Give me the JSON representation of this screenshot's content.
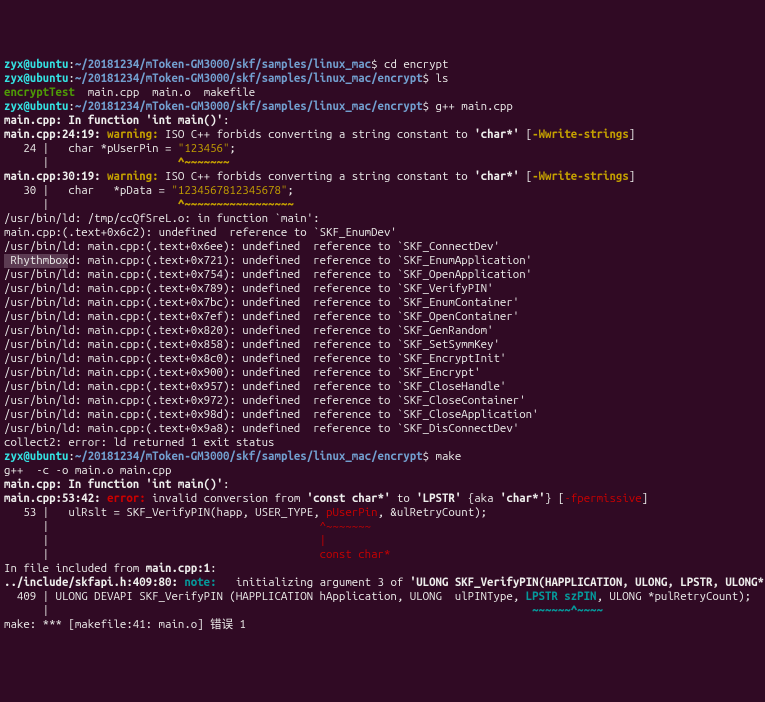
{
  "prompt": {
    "user": "zyx@ubuntu",
    "path1": "~/20181234/mToken-GM3000/skf/samples/linux_mac",
    "path2": "~/20181234/mToken-GM3000/skf/samples/linux_mac/encrypt",
    "dollar": "$"
  },
  "cmds": {
    "cd": "cd encrypt",
    "ls": "ls",
    "gpp": "g++ main.cpp",
    "make": "make"
  },
  "ls_out": {
    "exe": "encryptTest",
    "f1": "main.cpp",
    "f2": "main.o",
    "f3": "makefile"
  },
  "gpp": {
    "infunc": "main.cpp: In function",
    "infunc_b": "'int main()'",
    "infunc_c": ":",
    "w1a": "main.cpp:24:19:",
    "warn": "warning:",
    "w1b": "ISO C++ forbids converting a string constant to",
    "w1c": "'char*'",
    "w1d": " [",
    "w1opt": "-Wwrite-strings",
    "w1e": "]",
    "l24a": "   24 |   char *pUserPin = ",
    "l24b": "\"123456\"",
    "l24c": ";",
    "l24u": "      |                    ",
    "l24u2": "^~~~~~~~",
    "w2a": "main.cpp:30:19:",
    "w2b": "ISO C++ forbids converting a string constant to",
    "w2c": "'char*'",
    "l30a": "   30 |   char   *pData = ",
    "l30b": "\"1234567812345678\"",
    "l30c": ";",
    "l30u": "      |                    ",
    "l30u2": "^~~~~~~~~~~~~~~~~~",
    "ld_main": "/usr/bin/ld: /tmp/ccQfSreL.o: in function `main':",
    "ldp": "/usr/bin/ld: main.cpp:(.text+",
    "ld_first": "main.cpp:(.text+",
    "ldmid": "): undefined  reference to `",
    "refs": [
      {
        "off": "0x6c2",
        "sym": "SKF_EnumDev'"
      },
      {
        "off": "0x6ee",
        "sym": "SKF_ConnectDev'"
      },
      {
        "off": "0x721",
        "sym": "SKF_EnumApplication'"
      },
      {
        "off": "0x754",
        "sym": "SKF_OpenApplication'"
      },
      {
        "off": "0x789",
        "sym": "SKF_VerifyPIN'"
      },
      {
        "off": "0x7bc",
        "sym": "SKF_EnumContainer'"
      },
      {
        "off": "0x7ef",
        "sym": "SKF_OpenContainer'"
      },
      {
        "off": "0x820",
        "sym": "SKF_GenRandom'"
      },
      {
        "off": "0x858",
        "sym": "SKF_SetSymmKey'"
      },
      {
        "off": "0x8c0",
        "sym": "SKF_EncryptInit'"
      },
      {
        "off": "0x900",
        "sym": "SKF_Encrypt'"
      },
      {
        "off": "0x957",
        "sym": "SKF_CloseHandle'"
      },
      {
        "off": "0x972",
        "sym": "SKF_CloseContainer'"
      },
      {
        "off": "0x98d",
        "sym": "SKF_CloseApplication'"
      },
      {
        "off": "0x9a8",
        "sym": "SKF_DisConnectDev'"
      }
    ],
    "collect2": "collect2: error: ld returned 1 exit status",
    "rhythmbox": " Rhythmbox"
  },
  "make": {
    "line1": "g++  -c -o main.o main.cpp",
    "err1a": "main.cpp:53:42:",
    "err": "error:",
    "err1b": "invalid conversion from",
    "err1c": "'const char*'",
    "err1d": " to ",
    "err1e": "'LPSTR'",
    "err1f": " {aka ",
    "err1g": "'char*'",
    "err1h": "} [",
    "erropt": "-fpermissive",
    "err1i": "]",
    "l53a": "   53 |   ulRslt = SKF_VerifyPIN(happ, USER_TYPE, ",
    "l53b": "pUserPin",
    "l53c": ", &ulRetryCount);",
    "l53u1": "      |                                          ",
    "l53u2": "^~~~~~~~",
    "l53u3": "      |                                          ",
    "l53u4": "|",
    "l53u5": "      |                                          ",
    "l53u6": "const char*",
    "incl": "In file included from",
    "inclb": "main.cpp:1",
    "inclc": ":",
    "note1a": "../include/skfapi.h:409:80:",
    "note": "note:",
    "note1b": "  initializing argument 3 of",
    "note1c": "'ULONG SKF_VerifyPIN(HAPPLICATION, ULONG, LPSTR, ULONG*)'",
    "l409a": "  409 | ULONG DEVAPI SKF_VerifyPIN (HAPPLICATION hApplication, ULONG  ulPINType, ",
    "l409b": "LPSTR szPIN",
    "l409c": ", ULONG *pulRetryCount);",
    "l409u": "      |                                                                           ",
    "l409u2": "~~~~~~^~~~~",
    "mkerr": "make: *** [makefile:41: main.o] 错误 1"
  }
}
